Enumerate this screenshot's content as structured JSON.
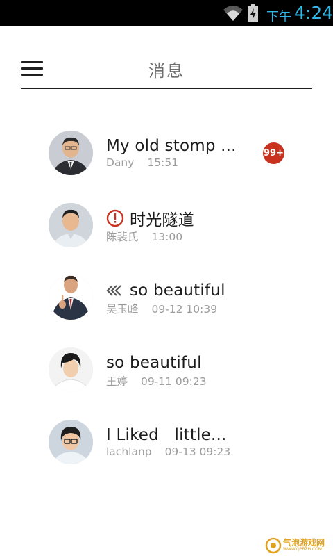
{
  "status_bar": {
    "ampm": "下午",
    "time": "4:24",
    "icons": [
      "wifi-icon",
      "battery-charging-icon"
    ],
    "accent_color": "#33b5e5"
  },
  "header": {
    "title": "消息",
    "menu_icon": "hamburger-menu-icon"
  },
  "messages": [
    {
      "title": "My old stomp ...",
      "sender": "Dany",
      "time": "15:51",
      "badge": "99+",
      "icon": null
    },
    {
      "title": "时光隧道",
      "sender": "陈裴氏",
      "time": "13:00",
      "badge": null,
      "icon": "alert-circle-icon"
    },
    {
      "title": "so beautiful",
      "sender": "吴玉峰",
      "time": "09-12 10:39",
      "badge": null,
      "icon": "double-chevron-left-icon"
    },
    {
      "title": "so beautiful",
      "sender": "王婷",
      "time": "09-11 09:23",
      "badge": null,
      "icon": null
    },
    {
      "title": "I Liked   little...",
      "sender": "lachlanp",
      "time": "09-13 09:23",
      "badge": null,
      "icon": null
    }
  ],
  "colors": {
    "badge": "#c8321e",
    "alert": "#c8321e",
    "meta_text": "#9c9c9c"
  },
  "watermark": {
    "text": "气泡游戏网",
    "sub": "WWW.QPBZH.COM"
  }
}
